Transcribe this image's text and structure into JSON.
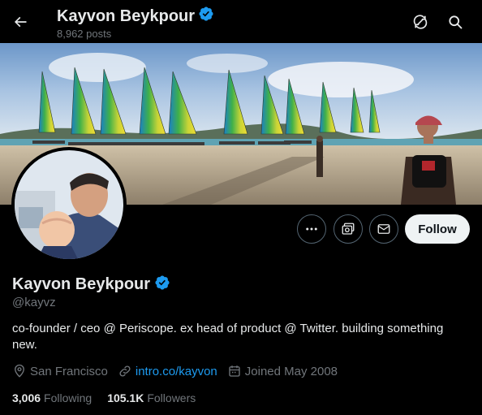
{
  "header": {
    "title": "Kayvon Beykpour",
    "post_count": "8,962 posts"
  },
  "profile": {
    "name": "Kayvon Beykpour",
    "handle": "@kayvz",
    "bio": "co-founder / ceo @ Periscope. ex head of product @ Twitter. building something new.",
    "location": "San Francisco",
    "website": "intro.co/kayvon",
    "joined": "Joined May 2008",
    "verified": true
  },
  "actions": {
    "follow_label": "Follow"
  },
  "stats": {
    "following_count": "3,006",
    "following_label": "Following",
    "followers_count": "105.1K",
    "followers_label": "Followers"
  },
  "colors": {
    "background": "#000000",
    "verified": "#1d9bf0",
    "link": "#1d9bf0",
    "secondary_text": "#71767b",
    "follow_button": "#eff3f4"
  },
  "icons": [
    "back-arrow-icon",
    "verified-badge-icon",
    "refresh-icon",
    "search-icon",
    "more-icon",
    "subscribe-icon",
    "message-icon",
    "location-icon",
    "link-icon",
    "calendar-icon"
  ]
}
